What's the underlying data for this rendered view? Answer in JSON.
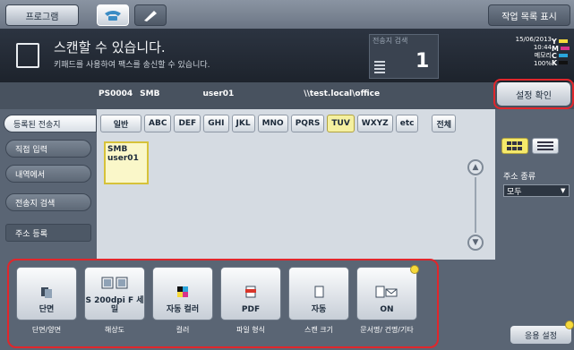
{
  "topbar": {
    "program_label": "프로그램",
    "joblist_label": "작업 목록 표시"
  },
  "message": {
    "main": "스캔할 수 있습니다.",
    "sub": "키패드를 사용하여 팩스를 송신할 수 있습니다.",
    "dest_count_label": "전송지 검색",
    "dest_count": "1"
  },
  "status": {
    "date": "15/06/2013",
    "time": "10:44",
    "memory_label": "메모리",
    "memory": "100%",
    "toner": [
      {
        "letter": "Y",
        "color": "#f6d93a"
      },
      {
        "letter": "M",
        "color": "#d7338c"
      },
      {
        "letter": "C",
        "color": "#2aa5dc"
      },
      {
        "letter": "K",
        "color": "#111111"
      }
    ]
  },
  "current_dest": {
    "id": "PS0004",
    "type": "SMB",
    "user": "user01",
    "path": "\\\\test.local\\office"
  },
  "settings_confirm_label": "설정 확인",
  "nav": {
    "registered": "등록된 전송지",
    "direct": "직접 입력",
    "history": "내역에서",
    "search": "전송지 검색",
    "register": "주소 등록"
  },
  "index_tabs": [
    "일반",
    "ABC",
    "DEF",
    "GHI",
    "JKL",
    "MNO",
    "PQRS",
    "TUV",
    "WXYZ",
    "etc",
    "전체"
  ],
  "index_selected": "TUV",
  "dest_tile": {
    "type": "SMB",
    "name": "user01"
  },
  "address_type": {
    "label": "주소 종류",
    "value": "모두"
  },
  "tiles": [
    {
      "value": "단면",
      "label": "단면/양면"
    },
    {
      "value": "S 200dpi F 세밀",
      "label": "해상도"
    },
    {
      "value": "자동 컬러",
      "label": "컬러"
    },
    {
      "value": "PDF",
      "label": "파일 형식"
    },
    {
      "value": "자동",
      "label": "스캔 크기"
    },
    {
      "value": "ON",
      "label": "문서명/ 건명/기타"
    }
  ],
  "app_settings_label": "응용 설정"
}
